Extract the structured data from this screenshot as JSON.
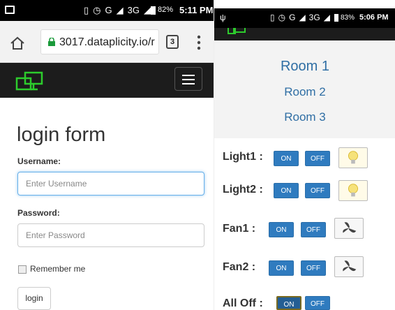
{
  "left_phone": {
    "status_bar": {
      "network": "G",
      "network2": "3G",
      "battery_pct": "82%",
      "time": "5:11 PM"
    },
    "browser": {
      "url": "3017.dataplicity.io/r",
      "tab_count": "3"
    },
    "page": {
      "title": "login form",
      "username_label": "Username:",
      "username_placeholder": "Enter Username",
      "password_label": "Password:",
      "password_placeholder": "Enter Password",
      "remember_label": "Remember me",
      "login_button": "login"
    }
  },
  "right_phone": {
    "status_bar": {
      "network": "G",
      "network2": "3G",
      "battery_pct": "83%",
      "time": "5:06 PM"
    },
    "rooms": [
      "Room 1",
      "Room 2",
      "Room 3"
    ],
    "devices": [
      {
        "label": "Light1 :",
        "on": "ON",
        "off": "OFF",
        "icon": "bulb-icon"
      },
      {
        "label": "Light2 :",
        "on": "ON",
        "off": "OFF",
        "icon": "bulb-icon"
      },
      {
        "label": "Fan1 :",
        "on": "ON",
        "off": "OFF",
        "icon": "fan-icon"
      },
      {
        "label": "Fan2 :",
        "on": "ON",
        "off": "OFF",
        "icon": "fan-icon"
      },
      {
        "label": "All Off :",
        "on": "ON",
        "off": "OFF",
        "icon": ""
      }
    ]
  },
  "colors": {
    "navbar": "#1c1c1c",
    "logo_green": "#2dcc2d",
    "room_blue": "#2f6ea4",
    "button_blue": "#2f7bbf"
  }
}
